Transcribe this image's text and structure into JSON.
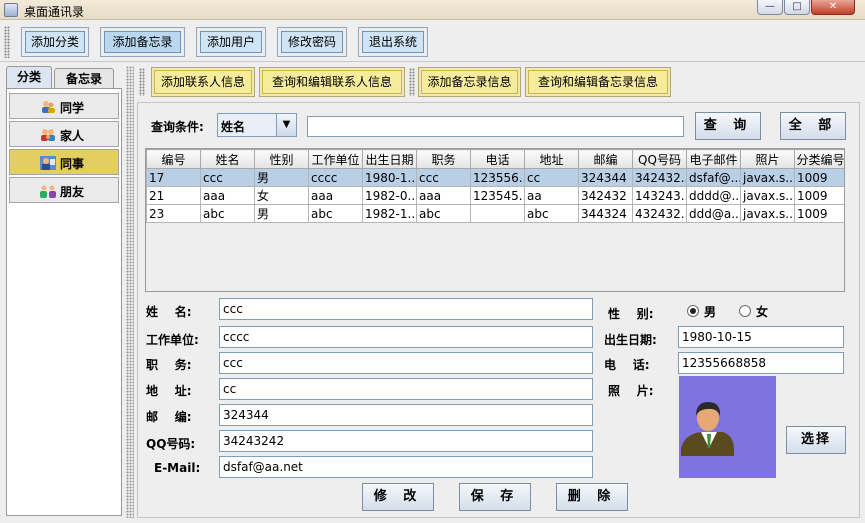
{
  "window": {
    "title": "桌面通讯录",
    "minimize_glyph": "—",
    "maximize_glyph": "□",
    "close_glyph": "✕"
  },
  "toolbar": {
    "add_category": "添加分类",
    "add_memo": "添加备忘录",
    "add_user": "添加用户",
    "change_password": "修改密码",
    "exit": "退出系统"
  },
  "left_tabs": [
    {
      "label": "分类",
      "selected": true
    },
    {
      "label": "备忘录",
      "selected": false
    }
  ],
  "categories": [
    {
      "label": "同学",
      "icon": "classmate-icon",
      "selected": false
    },
    {
      "label": "家人",
      "icon": "family-icon",
      "selected": false
    },
    {
      "label": "同事",
      "icon": "colleague-icon",
      "selected": true
    },
    {
      "label": "朋友",
      "icon": "friend-icon",
      "selected": false
    }
  ],
  "subtoolbar": {
    "add_contact": "添加联系人信息",
    "query_edit_contact": "查询和编辑联系人信息",
    "add_memo_info": "添加备忘录信息",
    "query_edit_memo": "查询和编辑备忘录信息"
  },
  "query": {
    "label": "查询条件:",
    "field_value": "姓名",
    "input_value": "",
    "search_button": "查 询",
    "all_button": "全 部"
  },
  "table": {
    "columns": [
      "编号",
      "姓名",
      "性别",
      "工作单位",
      "出生日期",
      "职务",
      "电话",
      "地址",
      "邮编",
      "QQ号码",
      "电子邮件",
      "照片",
      "分类编号"
    ],
    "rows": [
      [
        "17",
        "ccc",
        "男",
        "cccc",
        "1980-1...",
        "ccc",
        "123556...",
        "cc",
        "324344",
        "342432...",
        "dsfaf@...",
        "javax.s...",
        "1009"
      ],
      [
        "21",
        "aaa",
        "女",
        "aaa",
        "1982-0...",
        "aaa",
        "123545...",
        "aa",
        "342432",
        "143243...",
        "dddd@...",
        "javax.s...",
        "1009"
      ],
      [
        "23",
        "abc",
        "男",
        "abc",
        "1982-1...",
        "abc",
        "",
        "abc",
        "344324",
        "432432...",
        "ddd@a...",
        "javax.s...",
        "1009"
      ]
    ],
    "selected_row": 0
  },
  "form": {
    "name_label": "姓    名:",
    "name_value": "ccc",
    "company_label": "工作单位:",
    "company_value": "cccc",
    "position_label": "职    务:",
    "position_value": "ccc",
    "address_label": "地    址:",
    "address_value": "cc",
    "zip_label": "邮    编:",
    "zip_value": "324344",
    "qq_label": "QQ号码:",
    "qq_value": "34243242",
    "email_label": "E-Mail:",
    "email_value": "dsfaf@aa.net",
    "gender_label": "性    别:",
    "gender_male": "男",
    "gender_female": "女",
    "gender_selected": "男",
    "birth_label": "出生日期:",
    "birth_value": "1980-10-15",
    "phone_label": "电    话:",
    "phone_value": "12355668858",
    "photo_label": "照    片:",
    "photo_icon": "person-avatar-icon",
    "photo_bg": "#7f73e0",
    "choose_button": "选择"
  },
  "actions": {
    "modify": "修 改",
    "save": "保 存",
    "delete": "删 除"
  },
  "colors": {
    "selected_category": "#e3cf60",
    "selected_row": "#b8cfe5",
    "toolbar_button": "#cfe4f4",
    "sub_button": "#f7ec9c"
  }
}
